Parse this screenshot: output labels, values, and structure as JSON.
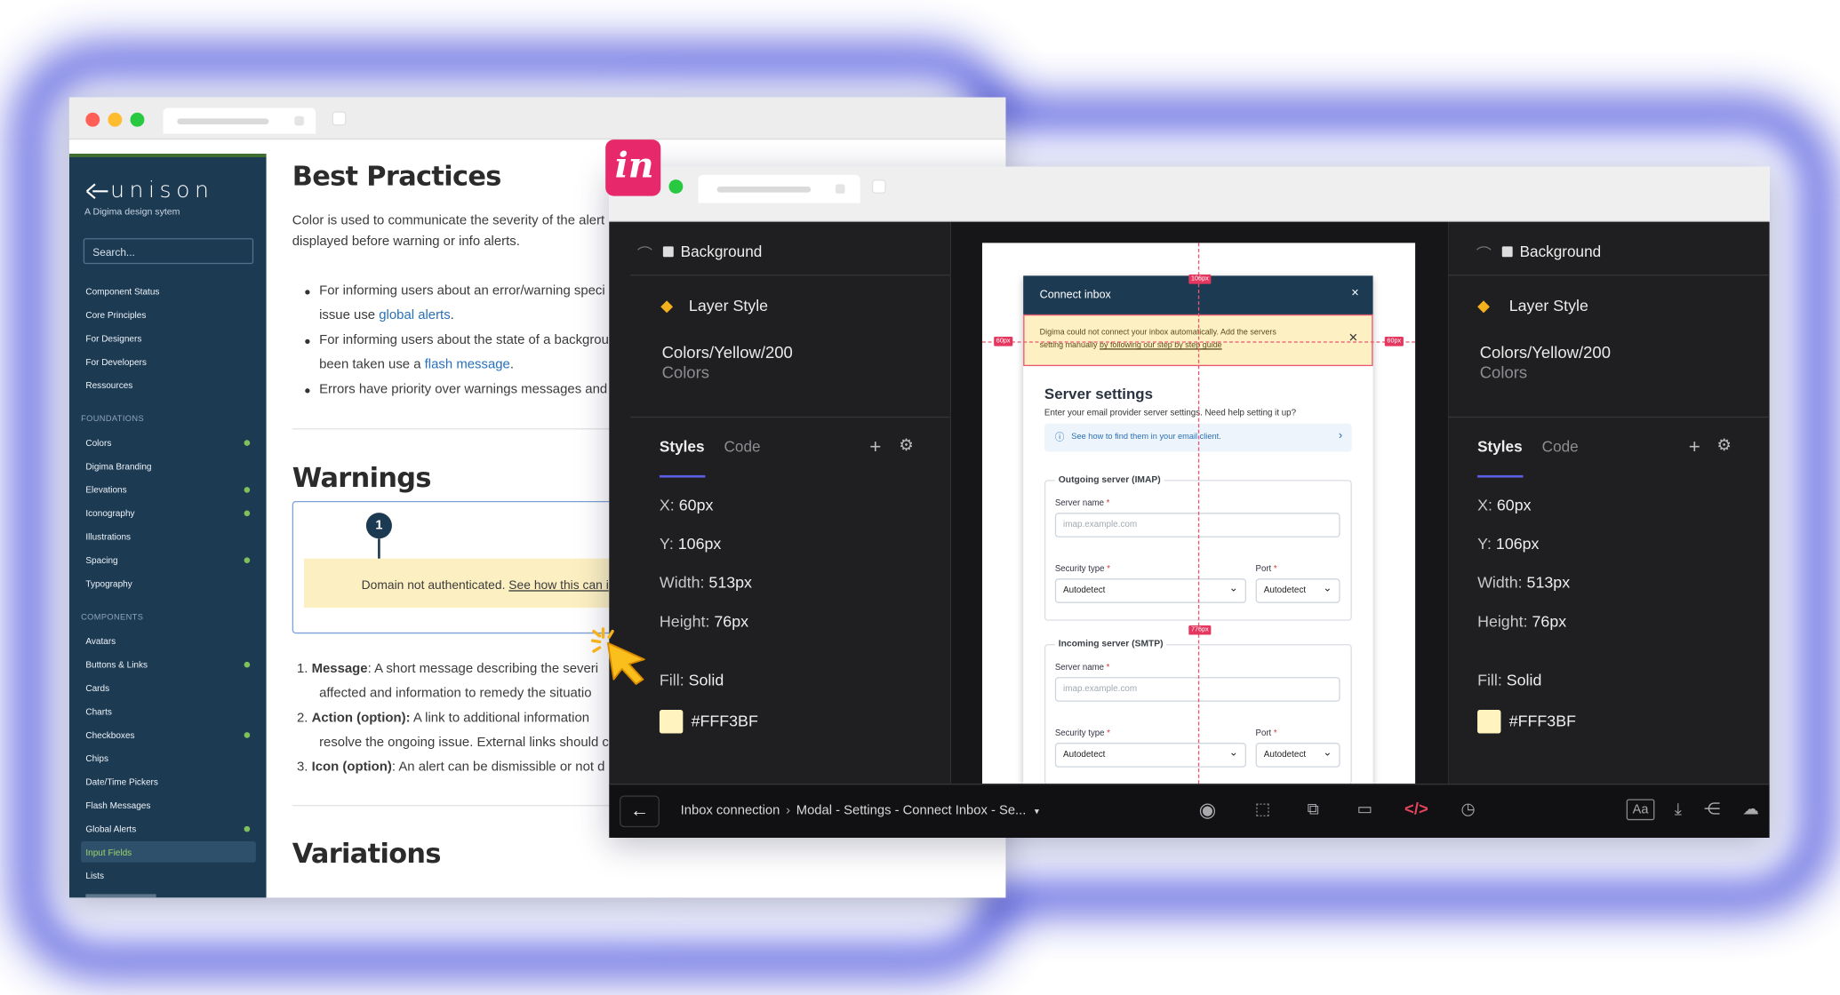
{
  "doc_window": {
    "logo": "unison",
    "tagline": "A Digima design sytem",
    "search_placeholder": "Search...",
    "nav_top": [
      "Component Status",
      "Core Principles",
      "For Designers",
      "For Developers",
      "Ressources"
    ],
    "foundations_heading": "FOUNDATIONS",
    "foundations": [
      "Colors",
      "Digima Branding",
      "Elevations",
      "Iconography",
      "Illustrations",
      "Spacing",
      "Typography"
    ],
    "components_heading": "COMPONENTS",
    "components": [
      "Avatars",
      "Buttons & Links",
      "Cards",
      "Charts",
      "Checkboxes",
      "Chips",
      "Date/Time Pickers",
      "Flash Messages",
      "Global Alerts",
      "Input Fields",
      "Lists"
    ],
    "active_item": "Input Fields",
    "title_best": "Best Practices",
    "intro_1": "Color is used to communicate the severity of the alert",
    "intro_2": "displayed before warning or info alerts.",
    "b1_a": "For informing users about an error/warning speci",
    "b1_b": "issue use ",
    "b1_link": "global alerts",
    "b1_end": ".",
    "b2_a": "For informing users about the state of a backgrou",
    "b2_b": "been taken use a ",
    "b2_link": "flash message",
    "b2_end": ".",
    "b3": "Errors have priority over warnings messages and",
    "title_warnings": "Warnings",
    "marker": "1",
    "alert_text": "Domain not authenticated.",
    "alert_link": "See how this can i",
    "list1_no": "1.",
    "list1_bold": "Message",
    "list1_a": ": A short message describing the severi",
    "list1_b": "affected and information to remedy the situatio",
    "list2_no": "2.",
    "list2_bold": "Action (option):",
    "list2_a": " A link to additional information",
    "list2_b": "resolve the ongoing issue. External links should c",
    "list3_no": "3.",
    "list3_bold": "Icon (option)",
    "list3_a": ": An alert can be dismissible or not d",
    "title_variations": "Variations"
  },
  "invision": {
    "logo": "in",
    "layer_name": "Background",
    "layer_style_label": "Layer Style",
    "style_name": "Colors/Yellow/200",
    "style_group": "Colors",
    "tab_styles": "Styles",
    "tab_code": "Code",
    "x_label": "X:",
    "x_value": "60px",
    "y_label": "Y:",
    "y_value": "106px",
    "w_label": "Width:",
    "w_value": "513px",
    "h_label": "Height:",
    "h_value": "76px",
    "fill_label": "Fill:",
    "fill_value": "Solid",
    "color_hex": "#FFF3BF",
    "breadcrumb_a": "Inbox connection",
    "breadcrumb_b": "Modal - Settings - Connect Inbox - Se...",
    "accent": "#5b5fe8"
  },
  "mock": {
    "header": "Connect inbox",
    "warn_text": "Digima could not connect your inbox automatically. Add the servers",
    "warn_text2": "setting manually ",
    "warn_link": "by following our step by step guide",
    "title": "Server settings",
    "subtitle": "Enter your email provider server settings. Need help setting it up?",
    "help_link": "See how to find them in your email client.",
    "outgoing_title": "Outgoing server (IMAP)",
    "incoming_title": "Incoming server (SMTP)",
    "server_name": "Server name",
    "server_placeholder_1": "imap.example.com",
    "server_placeholder_2": "imap.example.com",
    "security_type": "Security type",
    "port": "Port",
    "autodetect": "Autodetect",
    "m_106": "106px",
    "m_60l": "60px",
    "m_60r": "60px",
    "m_776": "776px"
  }
}
